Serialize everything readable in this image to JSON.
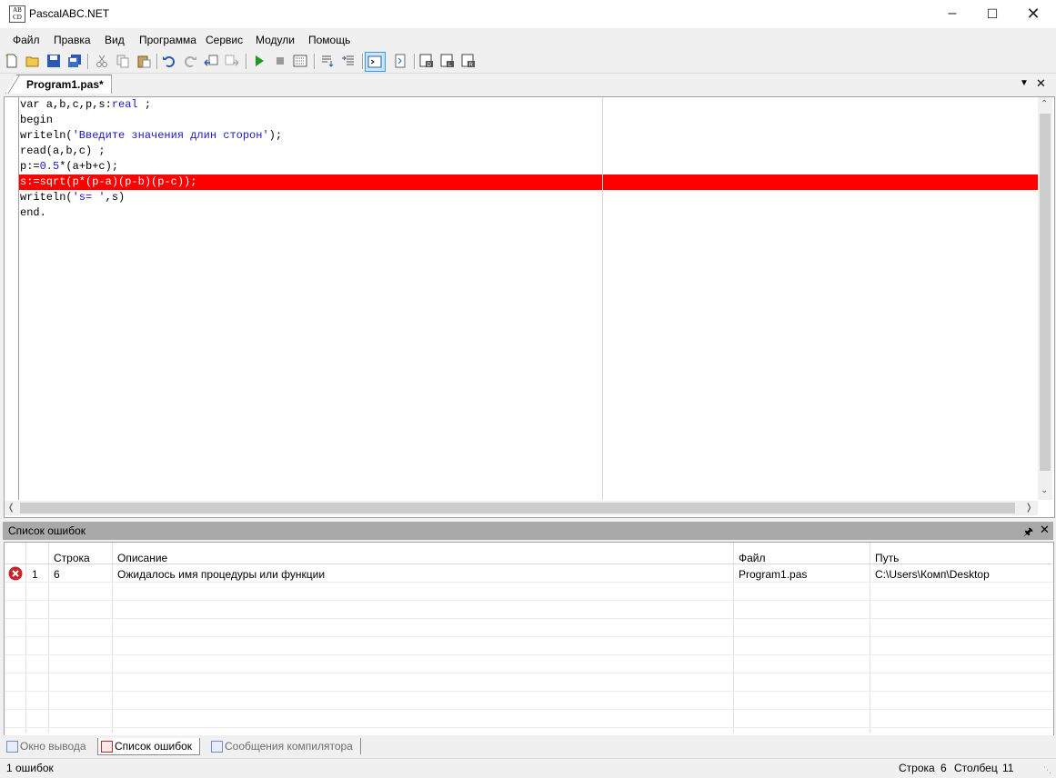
{
  "window": {
    "title": "PascalABC.NET",
    "icon_text": "AB\nCD"
  },
  "menu": [
    "Файл",
    "Правка",
    "Вид",
    "Программа",
    "Сервис",
    "Модули",
    "Помощь"
  ],
  "editor": {
    "tab_label": "Program1.pas*",
    "lines": [
      {
        "parts": [
          [
            "kw",
            "var a,b,c,p,s:"
          ],
          [
            "ty",
            "real"
          ],
          [
            "kw",
            " ;"
          ]
        ]
      },
      {
        "parts": [
          [
            "kw",
            "begin"
          ]
        ]
      },
      {
        "parts": [
          [
            "kw",
            "writeln("
          ],
          [
            "st",
            "'Введите значения длин сторон'"
          ],
          [
            "kw",
            ");"
          ]
        ]
      },
      {
        "parts": [
          [
            "kw",
            "read(a,b,c) ;"
          ]
        ]
      },
      {
        "parts": [
          [
            "kw",
            "p:="
          ],
          [
            "nm",
            "0.5"
          ],
          [
            "kw",
            "*(a+b+c);"
          ]
        ]
      },
      {
        "parts": [
          [
            "kw",
            "s:=sqrt(p*(p-a)(p-b)(p-c));"
          ]
        ],
        "highlight": true
      },
      {
        "parts": [
          [
            "kw",
            "writeln("
          ],
          [
            "st",
            "'s= '"
          ],
          [
            "kw",
            ",s)"
          ]
        ]
      },
      {
        "parts": [
          [
            "kw",
            "end."
          ]
        ]
      }
    ],
    "error_line_color": "#ff0000"
  },
  "error_panel": {
    "title": "Список ошибок",
    "columns": [
      "",
      "",
      "Строка",
      "Описание",
      "Файл",
      "Путь"
    ],
    "rows": [
      {
        "num": "1",
        "line": "6",
        "description": "Ожидалось имя процедуры или функции",
        "file": "Program1.pas",
        "path": "C:\\Users\\Комп\\Desktop"
      }
    ]
  },
  "bottom_tabs": [
    {
      "label": "Окно вывода",
      "active": false
    },
    {
      "label": "Список ошибок",
      "active": true
    },
    {
      "label": "Сообщения компилятора",
      "active": false
    }
  ],
  "status": {
    "errors": "1 ошибок",
    "line_label": "Строка",
    "line_value": "6",
    "col_label": "Столбец",
    "col_value": "11"
  }
}
